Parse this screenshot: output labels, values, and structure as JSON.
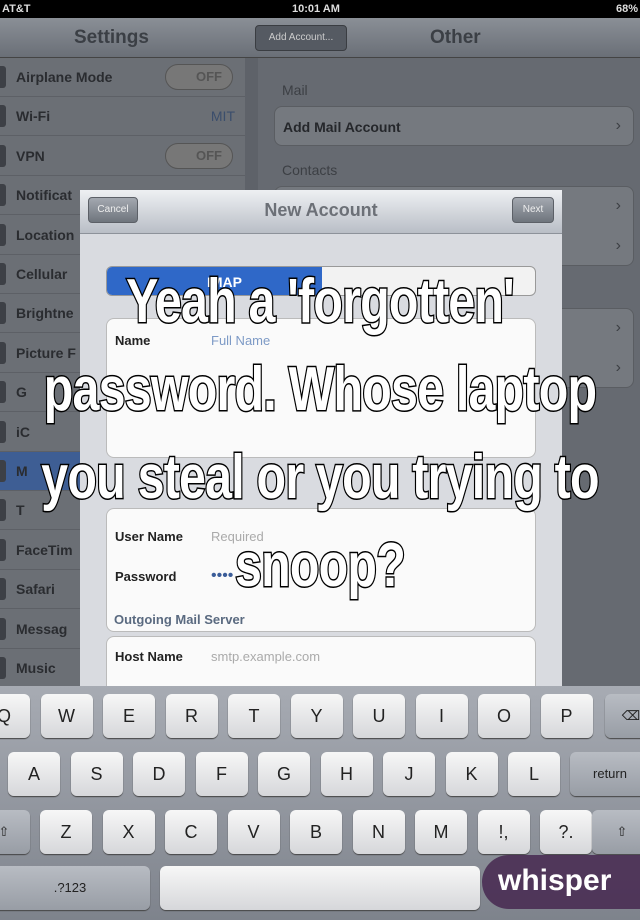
{
  "status": {
    "carrier": "AT&T",
    "time": "10:01 AM",
    "battery": "68%"
  },
  "nav": {
    "left_title": "Settings",
    "back_label": "Add Account...",
    "right_title": "Other"
  },
  "sidebar": {
    "items": [
      {
        "label": "Airplane Mode",
        "toggle": "OFF"
      },
      {
        "label": "Wi-Fi",
        "value": "MIT"
      },
      {
        "label": "VPN",
        "toggle": "OFF"
      },
      {
        "label": "Notificat"
      },
      {
        "label": "Location"
      },
      {
        "label": "Cellular"
      },
      {
        "label": "Brightne"
      },
      {
        "label": "Picture F"
      },
      {
        "label": "G"
      },
      {
        "label": "iC"
      },
      {
        "label": "M",
        "selected": true
      },
      {
        "label": "T"
      },
      {
        "label": "FaceTim"
      },
      {
        "label": "Safari"
      },
      {
        "label": "Messag"
      },
      {
        "label": "Music"
      }
    ]
  },
  "right": {
    "mail_section": "Mail",
    "add_mail": "Add Mail Account",
    "contacts_section": "Contacts"
  },
  "modal": {
    "cancel": "Cancel",
    "title": "New Account",
    "next": "Next",
    "segment_selected": "IMAP",
    "name_label": "Name",
    "name_placeholder": "Full Name",
    "username_label": "User Name",
    "username_placeholder": "Required",
    "password_label": "Password",
    "password_value": "••••",
    "outgoing_section": "Outgoing Mail Server",
    "host_label": "Host Name",
    "host_placeholder": "smtp.example.com"
  },
  "keyboard": {
    "row1": [
      "Q",
      "W",
      "E",
      "R",
      "T",
      "Y",
      "U",
      "I",
      "O",
      "P"
    ],
    "row2": [
      "A",
      "S",
      "D",
      "F",
      "G",
      "H",
      "J",
      "K",
      "L"
    ],
    "row3": [
      "Z",
      "X",
      "C",
      "V",
      "B",
      "N",
      "M",
      "!,",
      "?."
    ],
    "backspace": "⌫",
    "return": "return",
    "shift": "⇧",
    "numbers": ".?123"
  },
  "overlay": {
    "lines": [
      "Yeah a 'forgotten'",
      "password. Whose laptop",
      "you steal or you trying to",
      "snoop?"
    ]
  },
  "logo": {
    "text": "whisper"
  },
  "colors": {
    "selected_row": "#3e5e94",
    "segment": "#2f68c8",
    "logo_bg": "#462850"
  }
}
